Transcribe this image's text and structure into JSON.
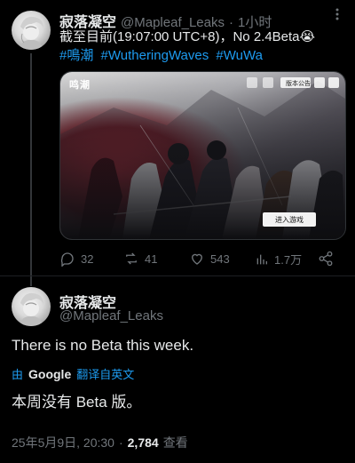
{
  "original_post": {
    "display_name": "寂落凝空",
    "handle": "@Mapleaf_Leaks",
    "separator": "·",
    "time": "1小时",
    "text_line1": "截至目前(19:07:00 UTC+8)，No 2.4Beta😭",
    "hashtags": [
      "#鳴潮",
      "#WutheringWaves",
      "#WuWa"
    ],
    "media": {
      "game_logo": "鸣潮",
      "start_button": "进入游戏",
      "corner_tag": "版本公告"
    },
    "actions": {
      "replies": "32",
      "reposts": "41",
      "likes": "543",
      "views": "1.7万"
    }
  },
  "reply_post": {
    "display_name": "寂落凝空",
    "handle": "@Mapleaf_Leaks",
    "text": "There is no Beta this week.",
    "translated_by_prefix": "由",
    "translated_by_brand": "Google",
    "translated_by_suffix": "翻译自英文",
    "translation": "本周没有 Beta 版。",
    "timestamp": "25年5月9日, 20:30",
    "meta_separator": "·",
    "view_count": "2,784",
    "view_label": "查看"
  },
  "colors": {
    "background": "#000000",
    "text_primary": "#e7e9ea",
    "text_secondary": "#71767b",
    "link": "#1d9bf0"
  }
}
